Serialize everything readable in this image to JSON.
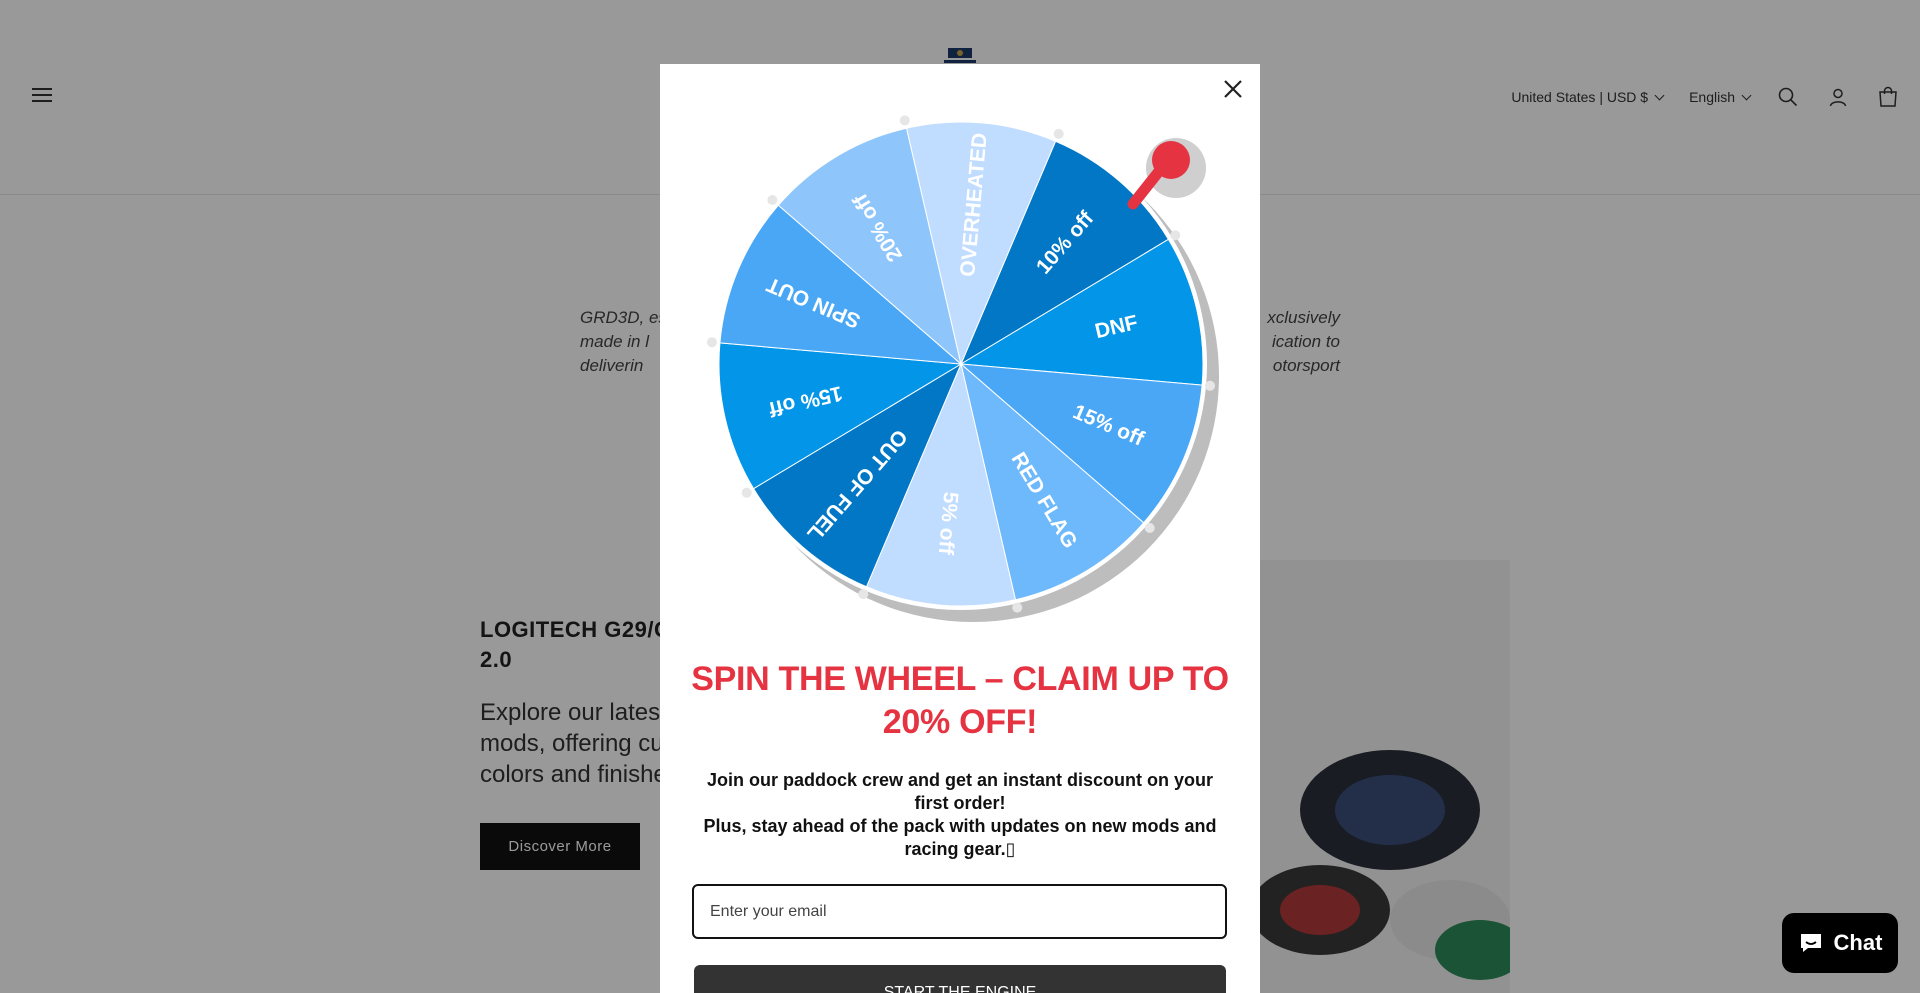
{
  "header": {
    "country": "United States | USD $",
    "language": "English"
  },
  "about": {
    "line1": "GRD3D, es",
    "line1_end": "xclusively",
    "line2": "made in l",
    "line2_end": "ication to",
    "line3": "deliverin",
    "line3_end": "otorsport"
  },
  "feature": {
    "title": "LOGITECH G29/G",
    "title_line2": "2.0",
    "text1": "Explore our latest",
    "text2": "mods, offering cu",
    "text3": "colors and finishe",
    "button": "Discover More"
  },
  "popup": {
    "title": "SPIN THE WHEEL – CLAIM UP TO 20% OFF!",
    "desc_line1": "Join our paddock crew and get an instant discount on your first order!",
    "desc_line2": "Plus, stay ahead of the pack with updates on new mods and racing gear.▯",
    "email_placeholder": "Enter your email",
    "start_button": "START THE ENGINE",
    "wheel_segments": [
      "10% off",
      "DNF",
      "15% off",
      "RED FLAG",
      "5% off",
      "OUT OF FUEL",
      "15% off",
      "SPIN OUT",
      "20% off",
      "OVERHEATED"
    ],
    "colors": {
      "title": "#e53342",
      "pointer": "#e53342",
      "segments": [
        "#0277c6",
        "#0395e8",
        "#4aa7f6",
        "#6eb9fb",
        "#c0dcff",
        "#0277c6",
        "#0395e8",
        "#4aa7f6",
        "#8ec6fb",
        "#c0dcff"
      ]
    }
  },
  "chat": {
    "label": "Chat"
  }
}
